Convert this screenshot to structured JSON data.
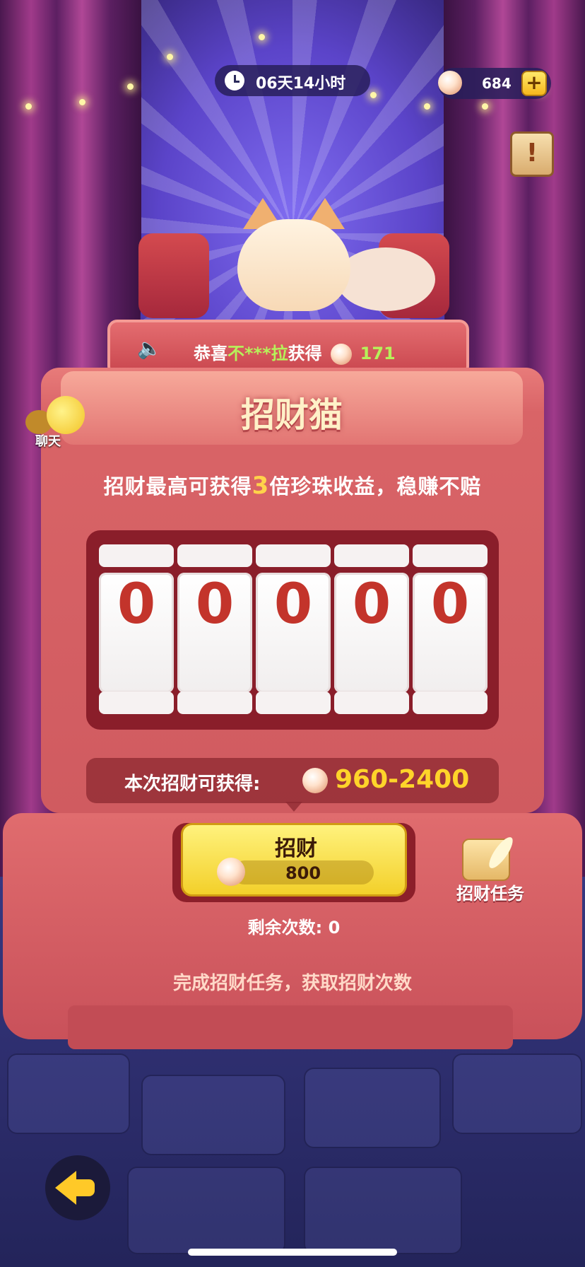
{
  "top_bar": {
    "timer": "06天14小时",
    "pearl_balance": "684",
    "add_label": "+",
    "notice_label": "!"
  },
  "ticker": {
    "prefix": "恭喜",
    "name": "不***拉",
    "suffix": "获得",
    "amount": "171"
  },
  "machine": {
    "title": "招财猫",
    "subtitle_before": "招财最高可获得",
    "subtitle_multiplier": "3",
    "subtitle_after": "倍珍珠收益，稳赚不赔",
    "reels": [
      "0",
      "0",
      "0",
      "0",
      "0"
    ],
    "reward_label": "本次招财可获得:",
    "reward_range": "960-2400"
  },
  "chat": {
    "label": "聊天"
  },
  "spin": {
    "label": "招财",
    "cost": "800"
  },
  "task": {
    "label": "招财任务"
  },
  "remaining": "剩余次数: 0",
  "hint": "完成招财任务，获取招财次数",
  "colors": {
    "machine": "#d96467",
    "button_yellow": "#f3d02a",
    "highlight_green": "#b6f15a",
    "reward_gold": "#ffd42a",
    "reel_digit": "#c3342b"
  },
  "icons": [
    "clock-icon",
    "pearl-icon",
    "plus-icon",
    "notice-icon",
    "speaker-icon",
    "chat-icon",
    "task-scroll-icon",
    "back-arrow-icon"
  ]
}
